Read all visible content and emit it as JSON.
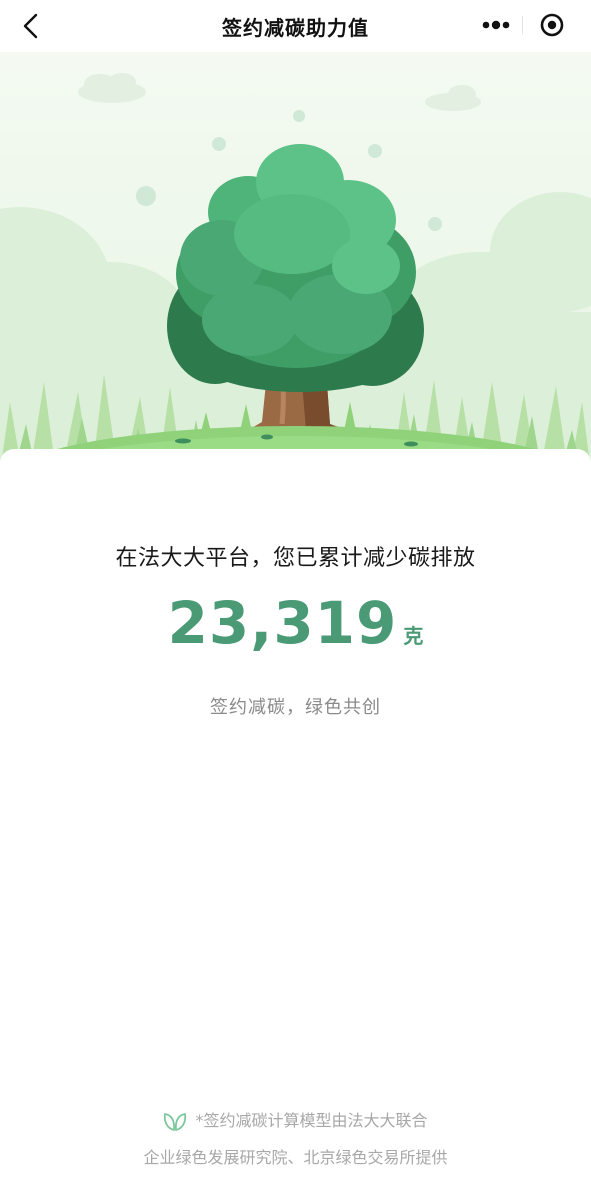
{
  "navbar": {
    "title": "签约减碳助力值",
    "back_icon": "chevron-left-icon",
    "more_icon": "more-dots-icon",
    "close_icon": "target-close-icon"
  },
  "illustration": {
    "subject": "tree-on-hill",
    "colors": {
      "sky": "#eef7ec",
      "tree_light": "#5cc287",
      "tree_mid": "#3f9e66",
      "tree_dark": "#2d7a4c",
      "trunk": "#8a5a3a",
      "grass": "#8fd27a"
    }
  },
  "card": {
    "headline": "在法大大平台，您已累计减少碳排放",
    "metric_value": "23,319",
    "metric_unit": "克",
    "slogan": "签约减碳，绿色共创",
    "footnote_line1": "*签约减碳计算模型由法大大联合",
    "footnote_line2": "企业绿色发展研究院、北京绿色交易所提供",
    "footnote_icon": "leaf-icon"
  },
  "colors": {
    "accent": "#4a9a75",
    "text_primary": "#1a1a1a",
    "text_secondary": "#8a8a8a",
    "text_muted": "#a8a8a8"
  }
}
